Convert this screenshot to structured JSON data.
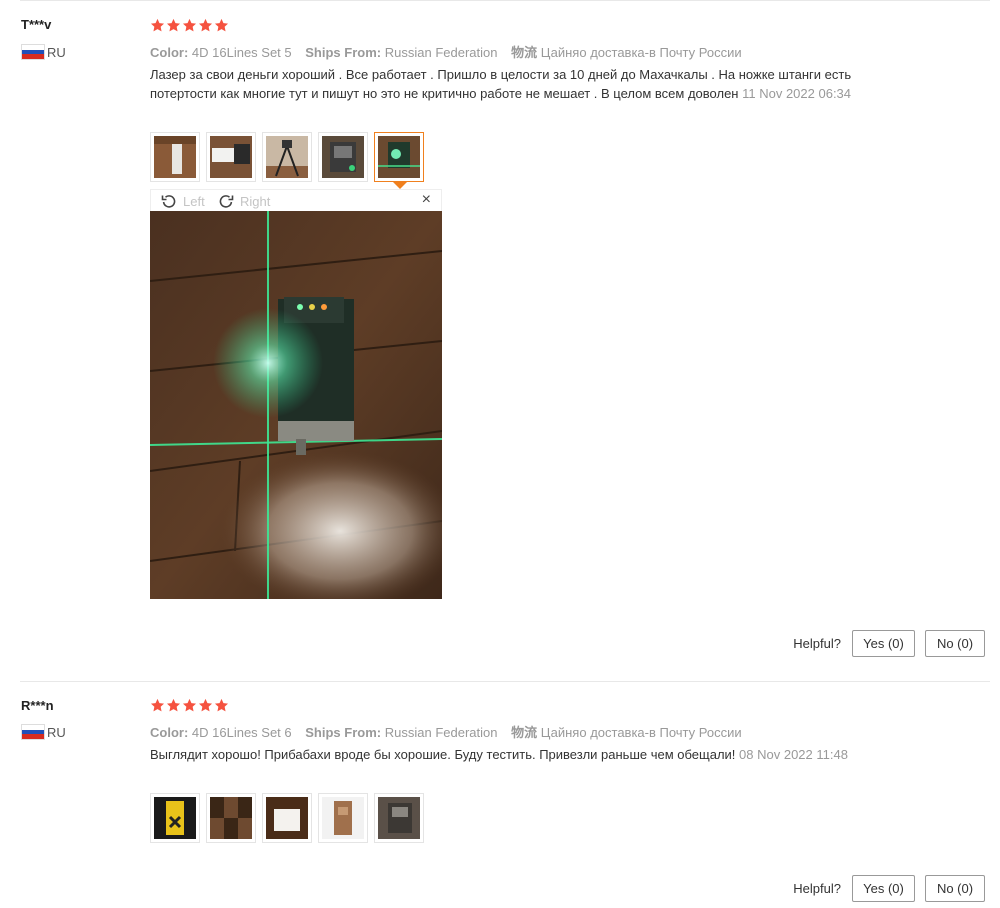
{
  "reviews": [
    {
      "user": "T***v",
      "country": "RU",
      "rating": 5,
      "meta": {
        "color_label": "Color:",
        "color_value": "4D 16Lines Set 5",
        "ships_label": "Ships From:",
        "ships_value": "Russian Federation",
        "logistics_label": "物流",
        "logistics_value": "Цайняо доставка-в Почту России"
      },
      "text": "Лазер за свои деньги хороший . Все работает . Пришло в целости за 10 дней до Махачкалы . На ножке штанги есть потертости как многие тут и пишут но это не критично работе не мешает . В целом всем доволен",
      "date": "11 Nov 2022 06:34",
      "photo_count": 5,
      "active_photo": 5,
      "viewer": {
        "left_label": "Left",
        "right_label": "Right",
        "close_icon": "×"
      },
      "helpful_label": "Helpful?",
      "yes_label": "Yes (0)",
      "no_label": "No (0)"
    },
    {
      "user": "R***n",
      "country": "RU",
      "rating": 5,
      "meta": {
        "color_label": "Color:",
        "color_value": "4D 16Lines Set 6",
        "ships_label": "Ships From:",
        "ships_value": "Russian Federation",
        "logistics_label": "物流",
        "logistics_value": "Цайняо доставка-в Почту России"
      },
      "text": "Выглядит хорошо! Прибабахи вроде бы хорошие. Буду тестить. Привезли раньше чем обещали!",
      "date": "08 Nov 2022 11:48",
      "photo_count": 5,
      "helpful_label": "Helpful?",
      "yes_label": "Yes (0)",
      "no_label": "No (0)"
    }
  ],
  "colors": {
    "star": "#f5523f",
    "accent": "#f0801e",
    "muted": "#999999",
    "flag_blue": "#1f4fb8",
    "flag_red": "#d52b1e"
  },
  "icons": {
    "star": "star-icon",
    "rotate_left": "rotate-left-icon",
    "rotate_right": "rotate-right-icon",
    "close": "close-icon",
    "flag": "russia-flag-icon"
  }
}
